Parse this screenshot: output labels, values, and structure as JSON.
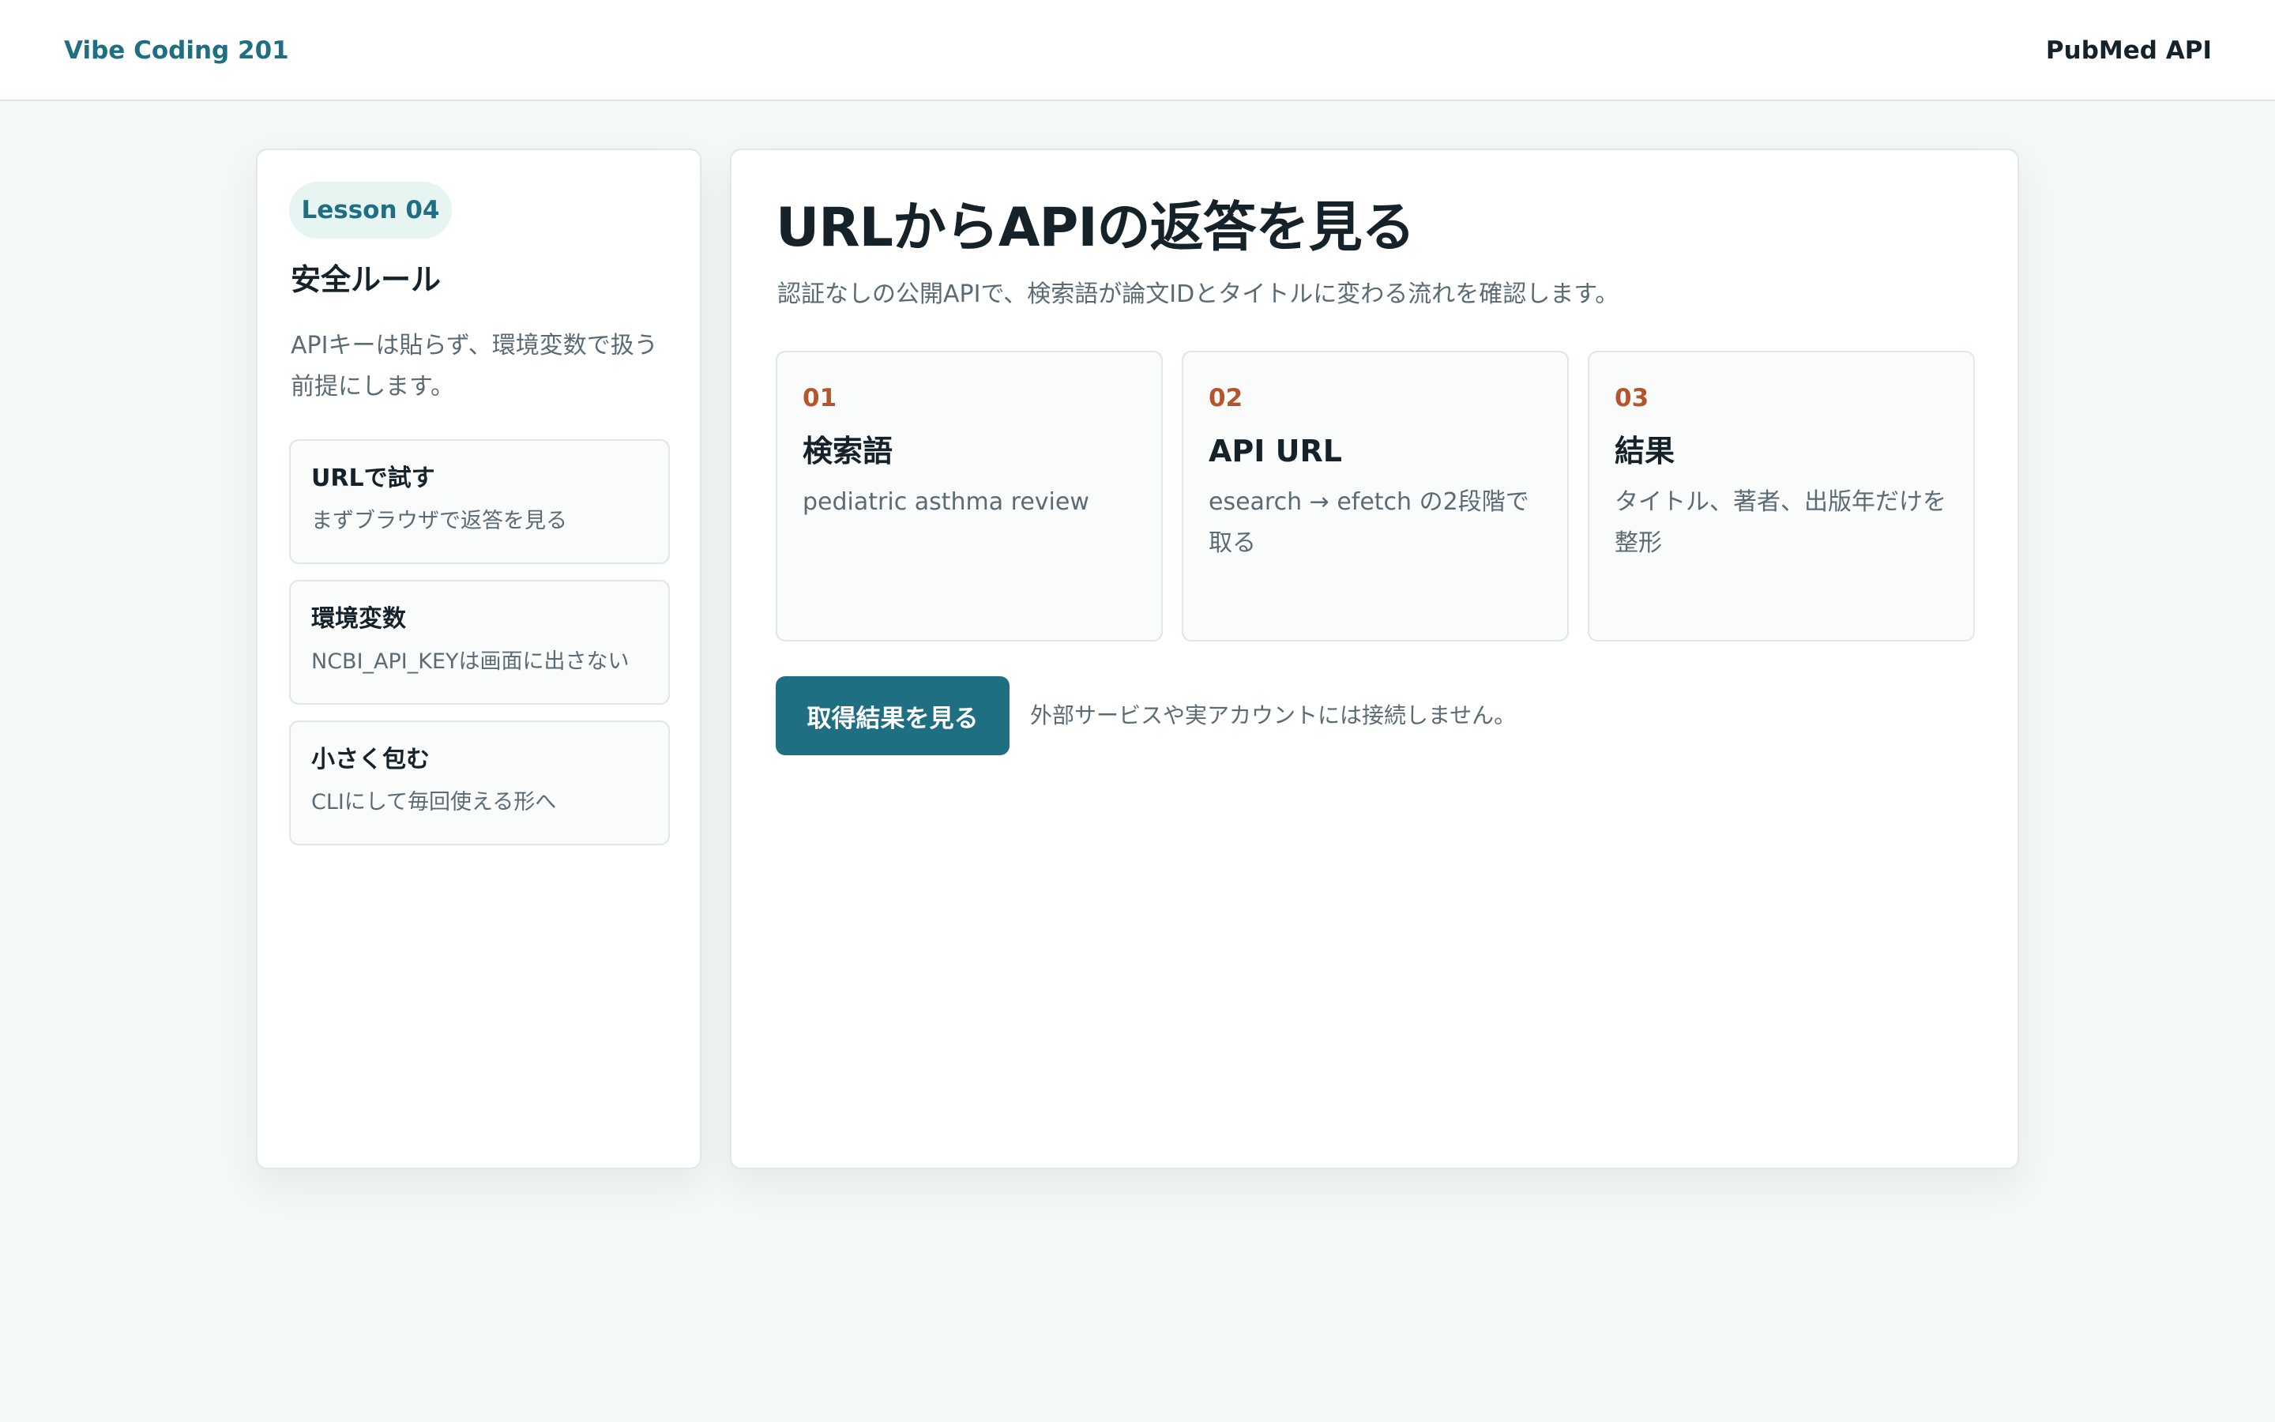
{
  "header": {
    "brand": "Vibe Coding 201",
    "topic": "PubMed API"
  },
  "sidebar": {
    "lesson_badge": "Lesson 04",
    "title": "安全ルール",
    "description": "APIキーは貼らず、環境変数で扱う前提にします。",
    "items": [
      {
        "title": "URLで試す",
        "subtitle": "まずブラウザで返答を見る"
      },
      {
        "title": "環境変数",
        "subtitle": "NCBI_API_KEYは画面に出さない"
      },
      {
        "title": "小さく包む",
        "subtitle": "CLIにして毎回使える形へ"
      }
    ]
  },
  "main": {
    "title": "URLからAPIの返答を見る",
    "subtitle": "認証なしの公開APIで、検索語が論文IDとタイトルに変わる流れを確認します。",
    "steps": [
      {
        "num": "01",
        "title": "検索語",
        "desc": "pediatric asthma review"
      },
      {
        "num": "02",
        "title": "API URL",
        "desc": "esearch → efetch の2段階で取る"
      },
      {
        "num": "03",
        "title": "結果",
        "desc": "タイトル、著者、出版年だけを整形"
      }
    ],
    "action_button": "取得結果を見る",
    "action_note": "外部サービスや実アカウントには接続しません。"
  },
  "colors": {
    "accent": "#1f6f83",
    "step_number": "#b4552d",
    "background": "#f4f8f7",
    "badge_bg": "#e6f4f2"
  }
}
